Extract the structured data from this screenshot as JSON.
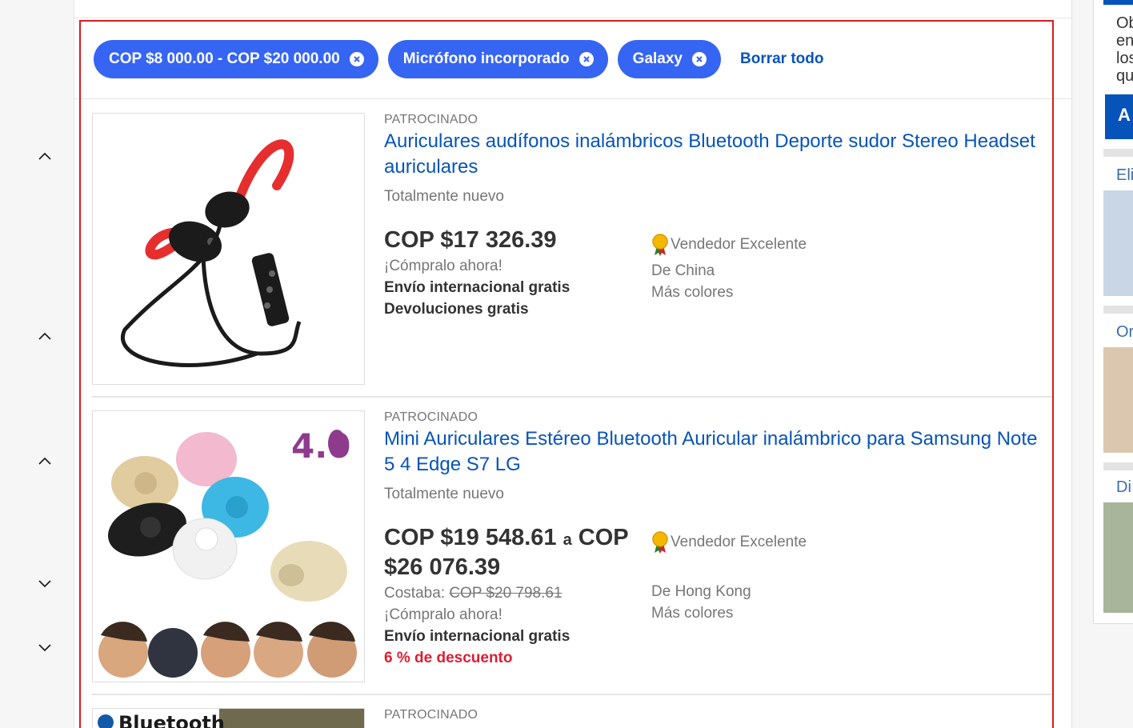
{
  "filters": {
    "chips": [
      {
        "label": "COP $8 000.00 - COP $20 000.00"
      },
      {
        "label": "Micrófono incorporado"
      },
      {
        "label": "Galaxy"
      }
    ],
    "clear_all": "Borrar todo"
  },
  "items": [
    {
      "sponsored": "PATROCINADO",
      "title": "Auriculares audífonos inalámbricos Bluetooth Deporte sudor Stereo Headset auriculares",
      "condition": "Totalmente nuevo",
      "price": "COP $17 326.39",
      "buy_now": "¡Cómpralo ahora!",
      "shipping": "Envío internacional gratis",
      "returns": "Devoluciones gratis",
      "seller_badge": "Vendedor Excelente",
      "origin": "De China",
      "more_colors": "Más colores"
    },
    {
      "sponsored": "PATROCINADO",
      "title": "Mini Auriculares Estéreo Bluetooth Auricular inalámbrico para Samsung Note 5 4 Edge S7 LG",
      "condition": "Totalmente nuevo",
      "price_from": "COP $19 548.61",
      "price_sep": "a",
      "price_to_a": "COP",
      "price_to_b": "$26 076.39",
      "was_label": "Costaba:",
      "was_price": "COP $20 798.61",
      "buy_now": "¡Cómpralo ahora!",
      "shipping": "Envío internacional gratis",
      "discount": "6 % de descuento",
      "seller_badge": "Vendedor Excelente",
      "origin": "De Hong Kong",
      "more_colors": "Más colores",
      "image_text": "4.0"
    },
    {
      "sponsored": "PATROCINADO",
      "image_text": "Bluetooth"
    }
  ],
  "right_rail": {
    "lines": [
      "Ob",
      "en",
      "los",
      "qu"
    ],
    "button": "A",
    "links": [
      "Eli",
      "Or",
      "Di"
    ]
  },
  "colors": {
    "accent": "#3665f3",
    "link": "#0654ba",
    "discount": "#dd1e31",
    "frame": "#d91c1c"
  }
}
